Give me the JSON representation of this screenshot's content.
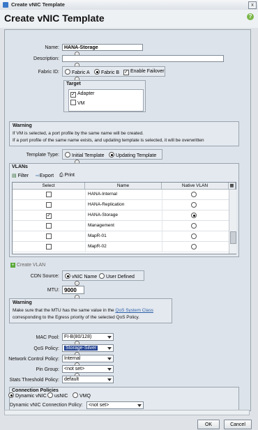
{
  "window": {
    "title": "Create vNIC Template",
    "close": "x"
  },
  "header": {
    "title": "Create vNIC Template",
    "help": "?"
  },
  "form": {
    "name_label": "Name:",
    "name_value": "HANA-Storage",
    "description_label": "Description:",
    "description_value": "",
    "fabric_label": "Fabric ID:",
    "fabric_a": "Fabric A",
    "fabric_b": "Fabric B",
    "enable_failover": "Enable Failover",
    "target": {
      "title": "Target",
      "adapter": "Adapter",
      "vm": "VM"
    },
    "warning1": {
      "title": "Warning",
      "line1": "If VM is selected, a port profile by the same name will be created.",
      "line2": "If a port profile of the same name exists, and updating template is selected, it will be overwritten"
    },
    "template_type_label": "Template Type:",
    "initial_template": "Initial Template",
    "updating_template": "Updating Template",
    "vlans": {
      "title": "VLANs",
      "toolbar": {
        "filter": "Filter",
        "export": "Export",
        "print": "Print"
      },
      "columns": [
        "Select",
        "Name",
        "Native VLAN"
      ],
      "rows": [
        {
          "name": "HANA-Internal",
          "selected": false,
          "native": false
        },
        {
          "name": "HANA-Replication",
          "selected": false,
          "native": false
        },
        {
          "name": "HANA-Storage",
          "selected": true,
          "native": true
        },
        {
          "name": "Management",
          "selected": false,
          "native": false
        },
        {
          "name": "MapR-01",
          "selected": false,
          "native": false
        },
        {
          "name": "MapR-02",
          "selected": false,
          "native": false
        }
      ]
    },
    "create_vlan": "Create VLAN",
    "cdn_label": "CDN Source:",
    "cdn_vnic_name": "vNIC Name",
    "cdn_user_defined": "User Defined",
    "mtu_label": "MTU:",
    "mtu_value": "9000",
    "warning2": {
      "title": "Warning",
      "line1_pre": "Make sure that the MTU has the same value in the ",
      "line1_link": "QoS System Class",
      "line2": "corresponding to the Egress priority of the selected QoS Policy."
    },
    "mac_pool_label": "MAC Pool:",
    "mac_pool_value": "FI-B(80/128)",
    "qos_label": "QoS Policy:",
    "qos_value": "Storage-Silver",
    "ncp_label": "Network Control Policy:",
    "ncp_value": "Internal",
    "pin_label": "Pin Group:",
    "pin_value": "<not set>",
    "stats_label": "Stats Threshold Policy:",
    "stats_value": "default",
    "connection": {
      "title": "Connection Policies",
      "dynamic_vnic": "Dynamic vNIC",
      "usnic": "usNIC",
      "vmq": "VMQ",
      "dyn_policy_label": "Dynamic vNIC Connection Policy:",
      "dyn_policy_value": "<not set>"
    }
  },
  "footer": {
    "ok": "OK",
    "cancel": "Cancel"
  }
}
